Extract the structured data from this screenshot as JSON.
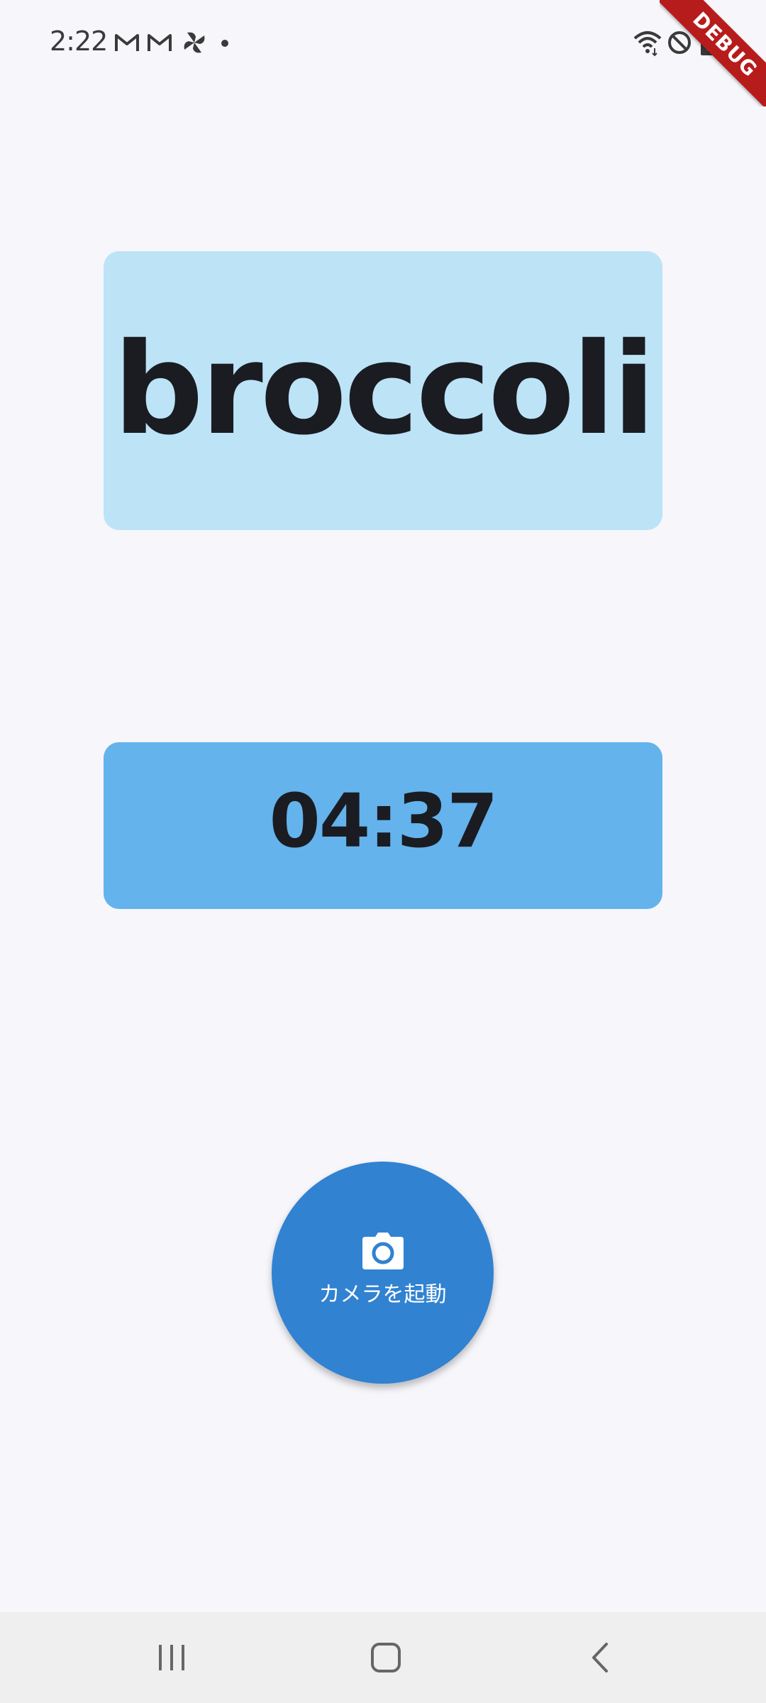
{
  "status_bar": {
    "time": "2:22"
  },
  "debug_banner": {
    "label": "DEBUG"
  },
  "word_card": {
    "word": "broccoli"
  },
  "timer": {
    "value": "04:37"
  },
  "camera_button": {
    "label": "カメラを起動",
    "icon": "camera-icon"
  },
  "nav_bar": {
    "items": [
      "recents",
      "home",
      "back"
    ]
  },
  "colors": {
    "background": "#f6f6fb",
    "word_card": "#bde3f7",
    "timer_card": "#64b3ec",
    "camera_button": "#3182d1",
    "debug_ribbon": "#b71c1c"
  }
}
